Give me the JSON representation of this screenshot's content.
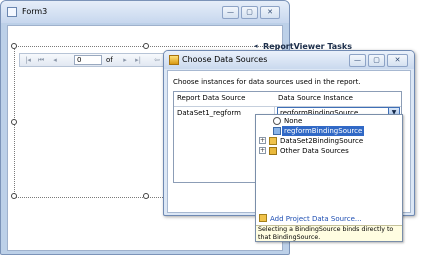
{
  "form": {
    "title": "Form3",
    "buttons": {
      "minimize": "—",
      "maximize": "▢",
      "close": "✕"
    }
  },
  "report_viewer": {
    "page_value": "0",
    "of_label": "of",
    "toolbar_icons": [
      "first-page-icon",
      "previous-page-icon",
      "next-page-icon",
      "last-page-icon",
      "back-icon"
    ]
  },
  "tasks_panel": {
    "title": "ReportViewer Tasks",
    "arrow": "◂"
  },
  "dialog": {
    "title": "Choose Data Sources",
    "instructions": "Choose instances for data sources used in the report.",
    "buttons": {
      "minimize": "—",
      "maximize": "▢",
      "close": "✕"
    },
    "grid": {
      "headers": [
        "Report Data Source",
        "Data Source Instance"
      ],
      "rows": [
        {
          "report_data_source": "DataSet1_regform",
          "data_source_instance": "regformBindingSource"
        }
      ]
    }
  },
  "dropdown": {
    "items": [
      {
        "label": "None",
        "icon": "none-icon"
      },
      {
        "label": "regformBindingSource",
        "icon": "binding-source-icon",
        "selected": true
      },
      {
        "label": "DataSet2BindingSource",
        "icon": "binding-source-icon"
      },
      {
        "label": "Other Data Sources",
        "icon": "data-sources-folder-icon"
      }
    ],
    "add_link": "Add Project Data Source...",
    "tip": "Selecting a BindingSource binds directly to that BindingSource."
  },
  "colors": {
    "selection": "#3169c6",
    "link": "#1f4fb3",
    "tip_background": "#fffde1"
  }
}
